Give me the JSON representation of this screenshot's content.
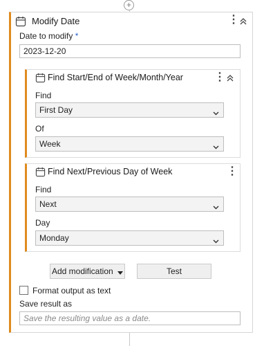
{
  "card": {
    "title": "Modify Date",
    "date_label": "Date to modify",
    "required_mark": "*",
    "date_value": "2023-12-20",
    "accent_color": "#e08a1e"
  },
  "steps": [
    {
      "title": "Find Start/End of Week/Month/Year",
      "field1_label": "Find",
      "field1_value": "First Day",
      "field2_label": "Of",
      "field2_value": "Week"
    },
    {
      "title": "Find Next/Previous Day of Week",
      "field1_label": "Find",
      "field1_value": "Next",
      "field2_label": "Day",
      "field2_value": "Monday"
    }
  ],
  "actions": {
    "add_modification": "Add modification",
    "test": "Test"
  },
  "options": {
    "format_output_label": "Format output as text",
    "format_output_checked": false
  },
  "save": {
    "label": "Save result as",
    "placeholder": "Save the resulting value as a date."
  },
  "icons": [
    "add-step-icon",
    "calendar-icon",
    "kebab-menu-icon",
    "collapse-icon",
    "chevron-down-icon",
    "caret-down-icon"
  ]
}
